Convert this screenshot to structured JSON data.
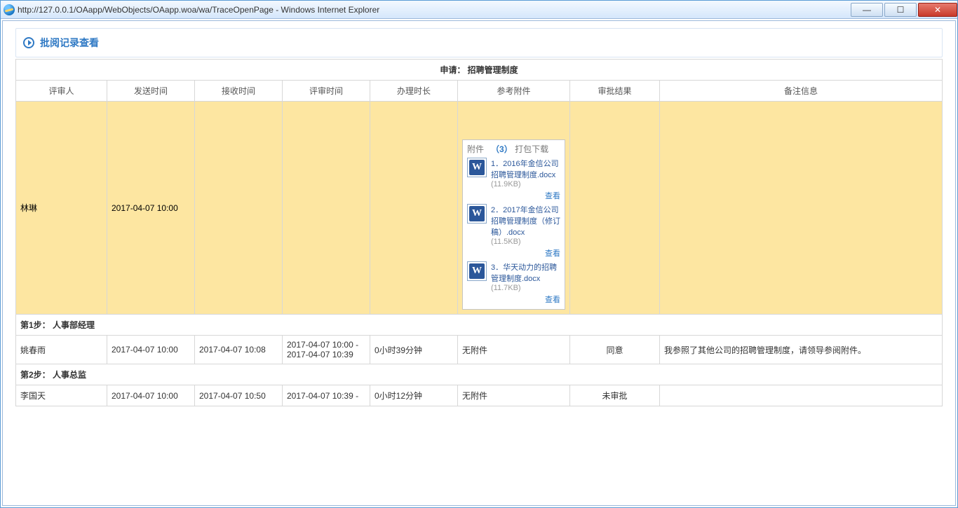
{
  "window": {
    "url_title": "http://127.0.0.1/OAapp/WebObjects/OAapp.woa/wa/TraceOpenPage - Windows Internet Explorer"
  },
  "panel_title": "批阅记录查看",
  "request_row": "申请： 招聘管理制度",
  "columns": {
    "reviewer": "评审人",
    "send_time": "发送时间",
    "recv_time": "接收时间",
    "review_time": "评审时间",
    "duration": "办理时长",
    "attachments": "参考附件",
    "result": "审批结果",
    "remark": "备注信息"
  },
  "first_row": {
    "reviewer": "林琳",
    "send_time": "2017-04-07 10:00",
    "attach": {
      "label": "附件",
      "count_prefix": "（",
      "count": "3",
      "count_suffix": "）",
      "download_all": "打包下载",
      "view_label": "查看",
      "items": [
        {
          "name": "1．2016年金信公司招聘管理制度.docx",
          "size": "(11.9KB)"
        },
        {
          "name": "2．2017年金信公司招聘管理制度（修订稿）.docx",
          "size": "(11.5KB)"
        },
        {
          "name": "3．华天动力的招聘管理制度.docx",
          "size": "(11.7KB)"
        }
      ]
    }
  },
  "step1": {
    "label": "第1步： 人事部经理",
    "reviewer": "姚春雨",
    "send_time": "2017-04-07 10:00",
    "recv_time": "2017-04-07 10:08",
    "review_time": "2017-04-07 10:00 - 2017-04-07 10:39",
    "duration": "0小时39分钟",
    "attachments": "无附件",
    "result": "同意",
    "remark": "我参照了其他公司的招聘管理制度，请领导参阅附件。"
  },
  "step2": {
    "label": "第2步： 人事总监",
    "reviewer": "李国天",
    "send_time": "2017-04-07 10:00",
    "recv_time": "2017-04-07 10:50",
    "review_time": "2017-04-07 10:39 -",
    "duration": "0小时12分钟",
    "attachments": "无附件",
    "result": "未审批",
    "remark": ""
  }
}
